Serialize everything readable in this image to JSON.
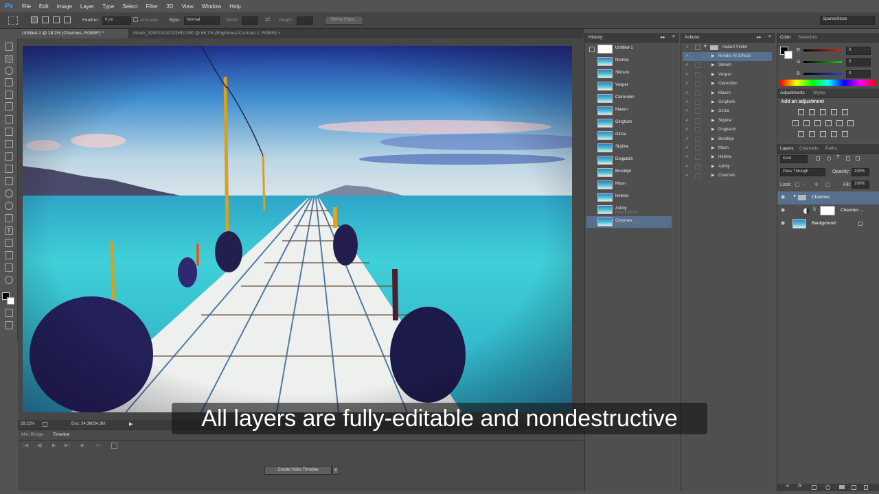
{
  "app": {
    "logo": "Ps"
  },
  "menu": [
    "File",
    "Edit",
    "Image",
    "Layer",
    "Type",
    "Select",
    "Filter",
    "3D",
    "View",
    "Window",
    "Help"
  ],
  "options": {
    "feather_label": "Feather:",
    "feather_value": "0 px",
    "antialias_label": "Anti-alias",
    "style_label": "Style:",
    "style_value": "Normal",
    "width_label": "Width:",
    "height_label": "Height:",
    "refine_button": "Refine Edge...",
    "workspace": "SparkleStock"
  },
  "tabs": [
    {
      "label": "Untitled-1 @ 28.2% (Charmes, RGB/8*) *"
    },
    {
      "label": "iStock_000023132703HD1080 @ 66.7% (Brightness/Contrast 1, RGB/8)"
    }
  ],
  "status": {
    "zoom": "28.22%",
    "doc": "Doc: 34.3M/34.3M"
  },
  "timeline": {
    "tabs": [
      "Mini Bridge",
      "Timeline"
    ],
    "create_button": "Create Video Timeline"
  },
  "history": {
    "title": "History",
    "snapshot": "Untitled-1",
    "items": [
      "Normal",
      "Stinson",
      "Vesper",
      "Clarendon",
      "Maven",
      "Gingham",
      "Ginza",
      "Skyline",
      "Dogpatch",
      "Brooklyn",
      "Moon",
      "Helena",
      "Ashby",
      "Charmes"
    ],
    "dim_items": [
      "Rise Eclipse",
      "Delete 1 Layer"
    ]
  },
  "actions": {
    "title": "Actions",
    "set_name": "Instant Vintler",
    "items": [
      "Render All Effects",
      "Slinwin",
      "Vesper",
      "Clarendon",
      "Maven",
      "Gingham",
      "Ginza",
      "Skyline",
      "Dogpatch",
      "Brooklyn",
      "Moon",
      "Helena",
      "Ashby",
      "Charmes"
    ]
  },
  "color": {
    "tabs": [
      "Color",
      "Swatches"
    ],
    "channels": [
      {
        "name": "R",
        "value": "0"
      },
      {
        "name": "G",
        "value": "0"
      },
      {
        "name": "B",
        "value": "0"
      }
    ]
  },
  "adjustments": {
    "tabs": [
      "Adjustments",
      "Styles"
    ],
    "subtitle": "Add an adjustment"
  },
  "layers": {
    "tabs": [
      "Layers",
      "Channels",
      "Paths"
    ],
    "kind": "Kind",
    "blend": "Pass Through",
    "opacity_label": "Opacity:",
    "opacity": "100%",
    "lock_label": "Lock:",
    "fill_label": "Fill:",
    "fill": "100%",
    "items": [
      {
        "name": "Charmes",
        "type": "group"
      },
      {
        "name": "Charmes ...",
        "type": "adjustment"
      },
      {
        "name": "Background",
        "type": "image"
      }
    ]
  },
  "caption": "All layers are fully-editable and nondestructive",
  "colors": {
    "accent": "#3fa0e8",
    "selection": "#56708e"
  }
}
